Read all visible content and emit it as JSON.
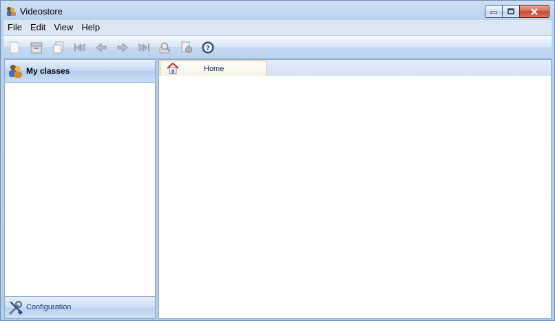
{
  "window": {
    "title": "Videostore",
    "icon": "videostore-app-icon",
    "controls": [
      "minimize",
      "maximize",
      "close"
    ]
  },
  "menu": [
    {
      "label": "File"
    },
    {
      "label": "Edit"
    },
    {
      "label": "View"
    },
    {
      "label": "Help"
    }
  ],
  "toolbar": {
    "buttons": [
      {
        "name": "new-icon"
      },
      {
        "name": "archive-icon"
      },
      {
        "name": "copy-icon"
      },
      {
        "name": "first-record-icon"
      },
      {
        "name": "previous-record-icon"
      },
      {
        "name": "next-record-icon"
      },
      {
        "name": "last-record-icon"
      },
      {
        "name": "search-icon"
      },
      {
        "name": "report-icon"
      },
      {
        "name": "help-icon"
      }
    ]
  },
  "left_panel": {
    "header": "My classes",
    "footer": "Configuration"
  },
  "tabs": [
    {
      "label": "Home",
      "icon": "home-icon",
      "active": true
    }
  ],
  "colors": {
    "tab_border": "#e3be5d",
    "panel_border": "#8aa9d1",
    "close_button": "#c44a33"
  }
}
